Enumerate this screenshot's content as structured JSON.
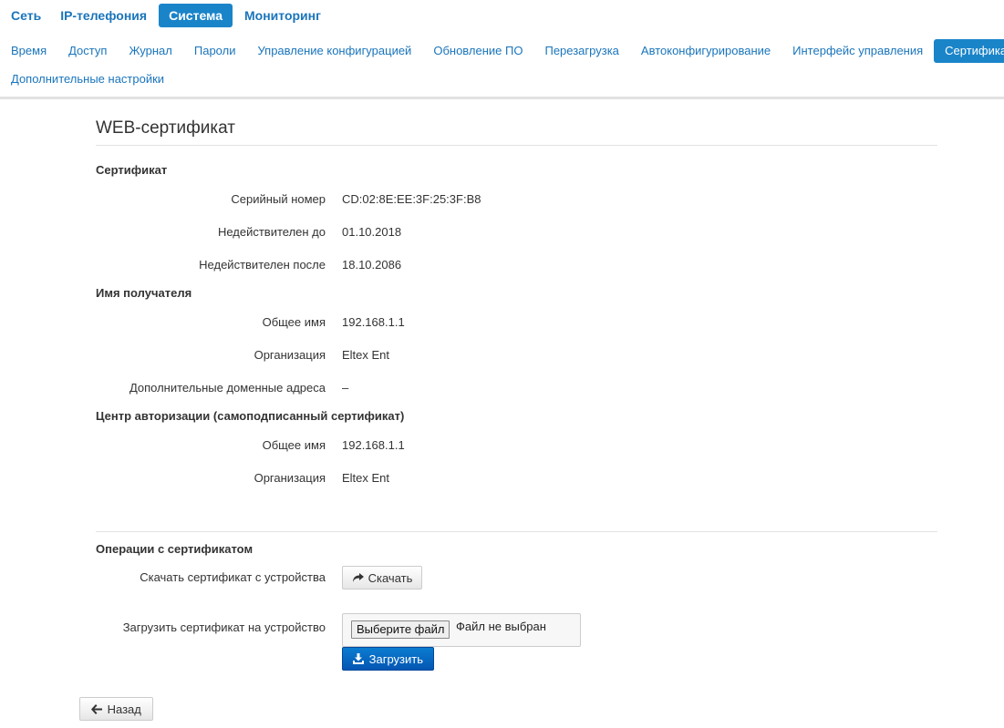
{
  "top_nav": [
    {
      "label": "Сеть",
      "active": false
    },
    {
      "label": "IP-телефония",
      "active": false
    },
    {
      "label": "Система",
      "active": true
    },
    {
      "label": "Мониторинг",
      "active": false
    }
  ],
  "sub_nav": [
    {
      "label": "Время",
      "active": false
    },
    {
      "label": "Доступ",
      "active": false
    },
    {
      "label": "Журнал",
      "active": false
    },
    {
      "label": "Пароли",
      "active": false
    },
    {
      "label": "Управление конфигурацией",
      "active": false
    },
    {
      "label": "Обновление ПО",
      "active": false
    },
    {
      "label": "Перезагрузка",
      "active": false
    },
    {
      "label": "Автоконфигурирование",
      "active": false
    },
    {
      "label": "Интерфейс управления",
      "active": false
    },
    {
      "label": "Сертификаты",
      "active": true
    },
    {
      "label": "Дополнительные настройки",
      "active": false
    }
  ],
  "page_title": "WEB-сертификат",
  "certificate": {
    "heading": "Сертификат",
    "serial_label": "Серийный номер",
    "serial_value": "CD:02:8E:EE:3F:25:3F:B8",
    "not_before_label": "Недействителен до",
    "not_before_value": "01.10.2018",
    "not_after_label": "Недействителен после",
    "not_after_value": "18.10.2086"
  },
  "subject": {
    "heading": "Имя получателя",
    "cn_label": "Общее имя",
    "cn_value": "192.168.1.1",
    "org_label": "Организация",
    "org_value": "Eltex Ent",
    "alt_label": "Дополнительные доменные адреса",
    "alt_value": "–"
  },
  "issuer": {
    "heading": "Центр авторизации (самоподписанный сертификат)",
    "cn_label": "Общее имя",
    "cn_value": "192.168.1.1",
    "org_label": "Организация",
    "org_value": "Eltex Ent"
  },
  "operations": {
    "heading": "Операции с сертификатом",
    "download_label": "Скачать сертификат с устройства",
    "download_button": "Скачать",
    "upload_label": "Загрузить сертификат на устройство",
    "choose_file_button": "Выберите файл",
    "file_status": "Файл не выбран",
    "upload_button": "Загрузить"
  },
  "back_button": "Назад",
  "colors": {
    "accent": "#1a84c9",
    "link": "#1a75bb",
    "primary_button": "#0a6fc6"
  }
}
